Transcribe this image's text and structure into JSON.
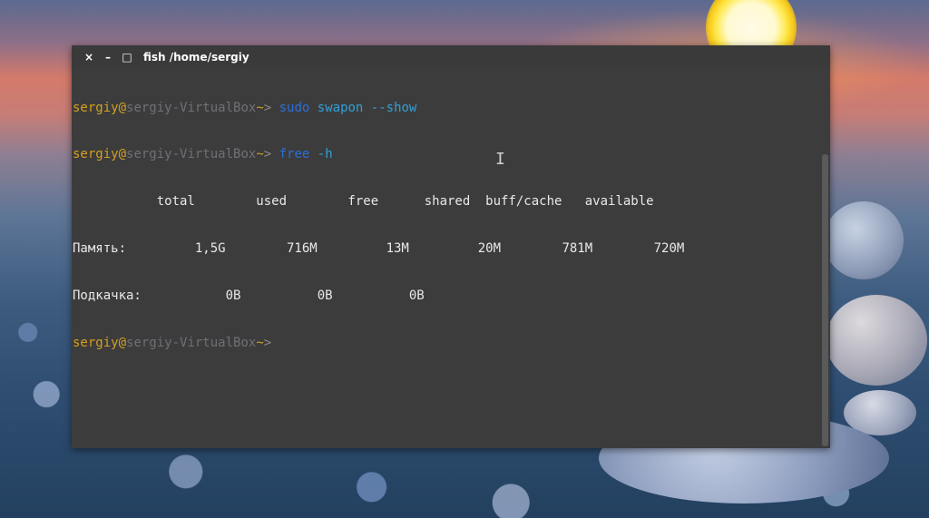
{
  "window": {
    "title": "fish  /home/sergiy",
    "close_glyph": "×",
    "minimize_glyph": "–",
    "maximize_glyph": "□"
  },
  "terminal": {
    "prompt": {
      "user": "sergiy",
      "at": "@",
      "host": "sergiy-VirtualBox",
      "tilde": "~",
      "arrow": ">"
    },
    "line1": {
      "cmd": "sudo",
      "args": "swapon --show"
    },
    "line2": {
      "cmd": "free",
      "args": "-h"
    },
    "header": "           total        used        free      shared  buff/cache   available",
    "mem_row": "Память:         1,5G        716M         13M         20M        781M        720M",
    "swap_row": "Подкачка:           0B          0B          0B"
  },
  "colors": {
    "prompt_user": "#d4a022",
    "prompt_host": "#6f6f77",
    "command": "#2b6ed8",
    "argument": "#2fa0d8",
    "terminal_bg": "#3c3c3c"
  }
}
